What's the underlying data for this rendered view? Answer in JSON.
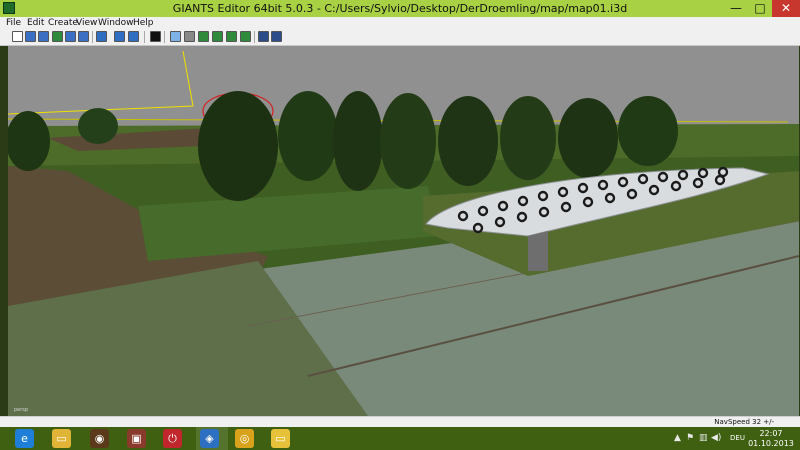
{
  "window": {
    "title": "GIANTS Editor 64bit 5.0.3 - C:/Users/Sylvio/Desktop/DerDroemling/map/map01.i3d",
    "minimize_glyph": "—",
    "maximize_glyph": "□",
    "close_glyph": "✕"
  },
  "menu": {
    "items": [
      {
        "label": "File"
      },
      {
        "label": "Edit"
      },
      {
        "label": "Create"
      },
      {
        "label": "View"
      },
      {
        "label": "Window"
      },
      {
        "label": "Help"
      }
    ]
  },
  "toolbar": {
    "icons": [
      {
        "name": "new-file-icon",
        "color": "#ffffff"
      },
      {
        "name": "open-file-icon",
        "color": "#3a6fc4"
      },
      {
        "name": "import-icon",
        "color": "#3a6fc4"
      },
      {
        "name": "save-icon",
        "color": "#2f8a3b"
      },
      {
        "name": "export-icon",
        "color": "#3a6fc4"
      },
      {
        "name": "cut-icon",
        "color": "#3a6fc4"
      },
      {
        "name": "refresh-icon",
        "color": "#2f6ec2"
      },
      {
        "name": "undo-icon",
        "color": "#2f6ec2"
      },
      {
        "name": "redo-icon",
        "color": "#2f6ec2"
      },
      {
        "name": "play-icon",
        "color": "#111111"
      },
      {
        "name": "select-icon",
        "color": "#7fb3e8"
      },
      {
        "name": "move-icon",
        "color": "#888888"
      },
      {
        "name": "terrain-sculpt-icon",
        "color": "#2f8a3b"
      },
      {
        "name": "terrain-paint-icon",
        "color": "#2f8a3b"
      },
      {
        "name": "foliage-paint-icon",
        "color": "#2f8a3b"
      },
      {
        "name": "terrain-texture-icon",
        "color": "#2f8a3b"
      },
      {
        "name": "settings-icon",
        "color": "#2d4c8a"
      },
      {
        "name": "tools-icon",
        "color": "#2d4c8a"
      }
    ]
  },
  "viewport": {
    "label": "persp"
  },
  "status": {
    "navspeed": "NavSpeed 32 +/-"
  },
  "taskbar": {
    "apps": [
      {
        "name": "internet-explorer-icon",
        "glyph": "e",
        "color": "#1f7fd8"
      },
      {
        "name": "file-explorer-icon",
        "glyph": "▭",
        "color": "#e0b436"
      },
      {
        "name": "media-player-icon",
        "glyph": "◉",
        "color": "#5a3a1a"
      },
      {
        "name": "farming-simulator-icon",
        "glyph": "▣",
        "color": "#8a3a2a"
      },
      {
        "name": "shutdown-icon",
        "glyph": "⏻",
        "color": "#c0262b"
      },
      {
        "name": "giants-editor-icon",
        "glyph": "◈",
        "color": "#2d6fc0"
      },
      {
        "name": "chrome-icon",
        "glyph": "◎",
        "color": "#d9a21b"
      },
      {
        "name": "folder-icon",
        "glyph": "▭",
        "color": "#e8c13a"
      }
    ],
    "tray": {
      "show_hidden_glyph": "▲",
      "flag_glyph": "⚑",
      "network_glyph": "▥",
      "volume_glyph": "◀)",
      "language": "DEU",
      "time": "22:07",
      "date": "01.10.2013"
    }
  }
}
